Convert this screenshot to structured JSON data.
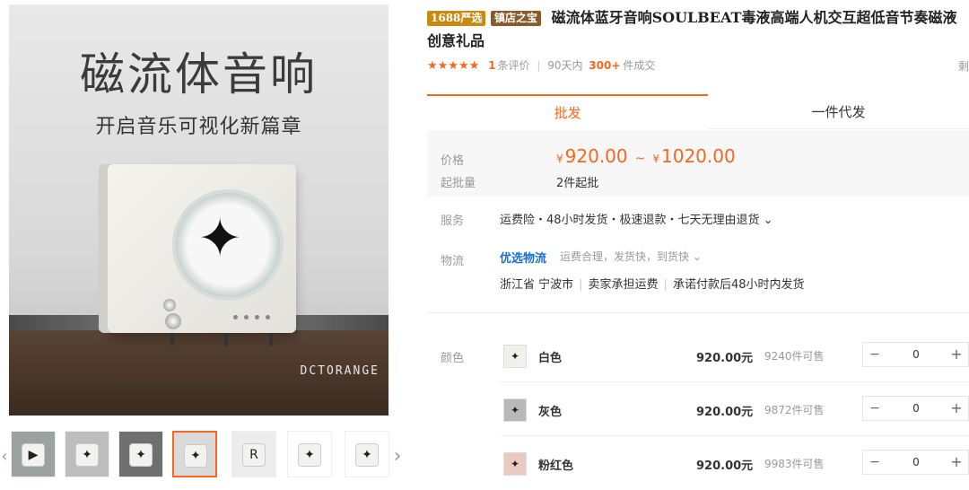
{
  "gallery": {
    "main_title": "磁流体音响",
    "main_subtitle": "开启音乐可视化新篇章",
    "brand_mark": "DCTORANGE",
    "prev_icon": "chevron-left-icon",
    "next_icon": "chevron-right-icon",
    "next_arrow": "›",
    "prev_arrow": "‹",
    "thumbnails": [
      {
        "mark": "▶"
      },
      {
        "mark": "✦"
      },
      {
        "mark": "✦"
      },
      {
        "mark": "✦"
      },
      {
        "mark": "R"
      },
      {
        "mark": "✦"
      },
      {
        "mark": "✦"
      }
    ],
    "active_thumbnail": 3
  },
  "product": {
    "badge_strict": "1688严选",
    "badge_treasure": "镇店之宝",
    "title": "磁流体蓝牙音响SOULBEAT毒液高端人机交互超低音节奏磁液创意礼品",
    "rating_stars": "★★★★★",
    "review_count": "1",
    "review_label": "条评价",
    "period_label": "90天内",
    "sold_count": "300+",
    "sold_label": "件成交",
    "edge_char": "剩"
  },
  "tabs": {
    "wholesale": "批发",
    "dropship": "一件代发"
  },
  "pricing": {
    "price_label": "价格",
    "currency": "¥",
    "price_min": "920.00",
    "tilde": "~",
    "price_max": "1020.00",
    "moq_label": "起批量",
    "moq_value": "2件起批"
  },
  "service": {
    "label": "服务",
    "text": "运费险・48小时发货・极速退款・七天无理由退货 ⌄"
  },
  "logistics": {
    "label": "物流",
    "brand": "优选物流",
    "desc": "运费合理，发货快，到货快 ⌄",
    "origin": "浙江省 宁波市",
    "freight": "卖家承担运费",
    "promise": "承诺付款后48小时内发货",
    "sep": "|"
  },
  "sku": {
    "color_label": "颜色",
    "items": [
      {
        "name": "白色",
        "price": "920.00元",
        "stock": "9240件可售",
        "qty": "0"
      },
      {
        "name": "灰色",
        "price": "920.00元",
        "stock": "9872件可售",
        "qty": "0"
      },
      {
        "name": "粉红色",
        "price": "920.00元",
        "stock": "9983件可售",
        "qty": "0"
      }
    ],
    "minus": "−",
    "plus": "+"
  },
  "colors": {
    "accent": "#f76720",
    "link": "#1a6fcc"
  }
}
